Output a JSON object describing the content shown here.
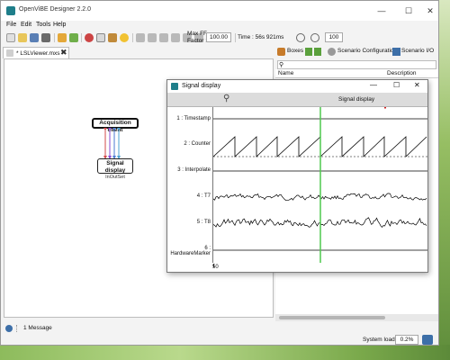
{
  "window": {
    "title": "OpenViBE Designer 2.2.0",
    "controls": {
      "minimize": "—",
      "maximize": "☐",
      "close": "✕"
    }
  },
  "menu": {
    "file": "File",
    "edit": "Edit",
    "tools": "Tools",
    "help": "Help"
  },
  "toolbar": {
    "max_ff_label_1": "Max FF",
    "max_ff_label_2": "Factor :",
    "max_ff_value": "100.00",
    "time_label": "Time : 56s 921ms",
    "zoom_value": "100",
    "icon_names": [
      "new-icon",
      "open-icon",
      "save-icon",
      "save-as-icon",
      "undo-icon",
      "redo-icon",
      "cut-icon",
      "copy-icon",
      "paste-icon",
      "comment-icon",
      "rewind-icon",
      "stop-icon",
      "pause-icon",
      "step-icon",
      "play-icon",
      "fast-forward-icon",
      "zoom-out-icon",
      "zoom-in-icon"
    ]
  },
  "tab": {
    "label": "* LSLViewer.mxs *"
  },
  "canvas": {
    "boxes": [
      {
        "title": "Acquisition client",
        "subtitle": ""
      },
      {
        "title": "Signal display",
        "subtitle": "InOutSet"
      }
    ]
  },
  "right_panel": {
    "tabs": [
      "Boxes",
      "Scenario Configuration",
      "Scenario I/O"
    ],
    "columns": [
      "Name",
      "Description"
    ]
  },
  "status": {
    "message_count": "1 Message",
    "system_load_label": "System load :",
    "system_load_value": "0.2%"
  },
  "signal_display": {
    "title": "Signal display",
    "toolbar_title": "Signal display",
    "channels": [
      "1 : Timestamp",
      "2 : Counter",
      "3 : Interpolate",
      "4 : T7",
      "5 : T8",
      "6 : HardwareMarker"
    ],
    "time_axis_start": "50",
    "colors": {
      "trace": "#000000",
      "cursor": "#4ec94e",
      "marker": "#cc2222"
    }
  }
}
